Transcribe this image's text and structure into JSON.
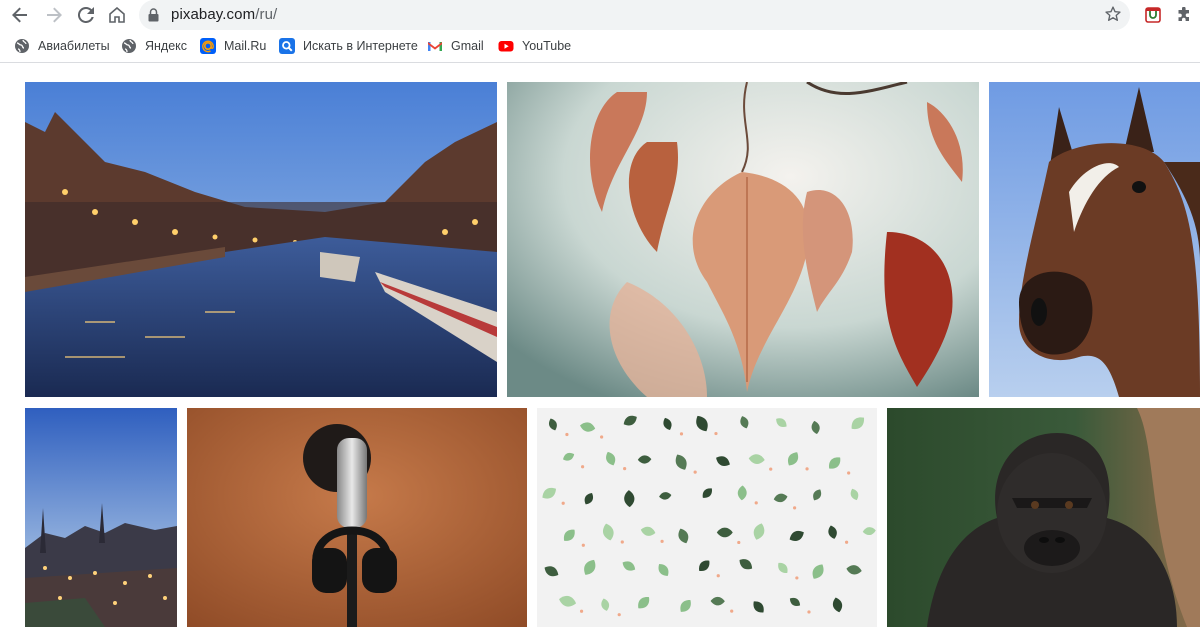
{
  "browser": {
    "url_host": "pixabay.com",
    "url_path": "/ru/",
    "icons": {
      "back": "arrow-left-icon",
      "forward": "arrow-right-icon",
      "reload": "reload-icon",
      "home": "home-icon",
      "lock": "lock-icon",
      "bookmark_star": "star-icon",
      "extension_1": "shield-extension-icon",
      "extensions": "puzzle-icon"
    }
  },
  "bookmarks": [
    {
      "label": "Авиабилеты",
      "icon": "globe-icon"
    },
    {
      "label": "Яндекс",
      "icon": "globe-icon"
    },
    {
      "label": "Mail.Ru",
      "icon": "mailru-icon"
    },
    {
      "label": "Искать в Интернете",
      "icon": "search-icon"
    },
    {
      "label": "Gmail",
      "icon": "gmail-icon"
    },
    {
      "label": "YouTube",
      "icon": "youtube-icon"
    }
  ],
  "photos": [
    {
      "subject": "amsterdam-canal-at-dusk"
    },
    {
      "subject": "autumn-leaves-closeup"
    },
    {
      "subject": "horse-head"
    },
    {
      "subject": "town-at-dusk"
    },
    {
      "subject": "microphone-with-headphones"
    },
    {
      "subject": "green-leaves-pattern"
    },
    {
      "subject": "gorilla"
    }
  ],
  "colors": {
    "omnibox_bg": "#f1f3f4",
    "youtube_red": "#ff0000",
    "mailru_blue": "#005ff9",
    "search_blue": "#1a73e8",
    "gmail_red": "#ea4335"
  }
}
